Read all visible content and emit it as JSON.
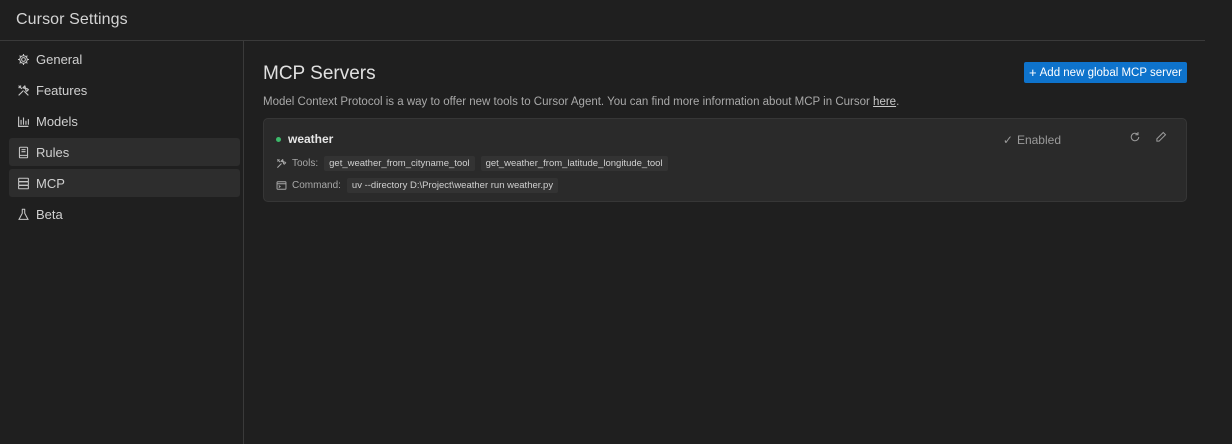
{
  "window": {
    "title": "Cursor Settings"
  },
  "sidebar": {
    "items": [
      {
        "label": "General",
        "icon": "gear-icon"
      },
      {
        "label": "Features",
        "icon": "tools-icon"
      },
      {
        "label": "Models",
        "icon": "bar-chart-icon"
      },
      {
        "label": "Rules",
        "icon": "book-icon"
      },
      {
        "label": "MCP",
        "icon": "server-icon"
      },
      {
        "label": "Beta",
        "icon": "flask-icon"
      }
    ]
  },
  "main": {
    "title": "MCP Servers",
    "add_button": "Add new global MCP server",
    "description": "Model Context Protocol is a way to offer new tools to Cursor Agent. You can find more information about MCP in Cursor",
    "description_link": "here",
    "description_end": ".",
    "server": {
      "name": "weather",
      "status_color": "#3cba6a",
      "status": "Enabled",
      "tools_label": "Tools:",
      "tools": [
        "get_weather_from_cityname_tool",
        "get_weather_from_latitude_longitude_tool"
      ],
      "command_label": "Command:",
      "command": "uv --directory D:\\Project\\weather run weather.py"
    }
  },
  "colors": {
    "accent": "#0e73cc",
    "background": "#1f1f1f",
    "card": "#2a2a2a"
  }
}
